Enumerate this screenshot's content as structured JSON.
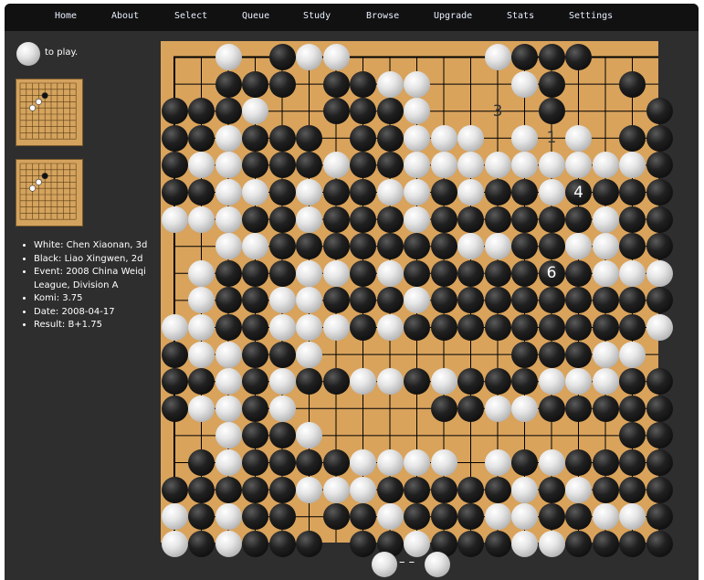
{
  "nav": {
    "items": [
      {
        "label": "Home"
      },
      {
        "label": "About"
      },
      {
        "label": "Select"
      },
      {
        "label": "Queue"
      },
      {
        "label": "Study"
      },
      {
        "label": "Browse"
      },
      {
        "label": "Upgrade"
      },
      {
        "label": "Stats"
      },
      {
        "label": "Settings"
      }
    ]
  },
  "to_play": {
    "color": "white",
    "label": "to play."
  },
  "game_info": {
    "items": [
      {
        "text": "White: Chen Xiaonan, 3d"
      },
      {
        "text": "Black: Liao Xingwen, 2d"
      },
      {
        "text": "Event: 2008 China Weiqi League, Division A"
      },
      {
        "text": "Komi: 3.75"
      },
      {
        "text": "Date: 2008-04-17"
      },
      {
        "text": "Result: B+1.75"
      }
    ]
  },
  "footer": {
    "separator": "– –"
  },
  "board": {
    "size": 19,
    "rows": [
      "..w.bww.....wbbb...",
      "..bbb.bbww...wb..b.",
      "bbbw..bbbw....b...b",
      "bbwbbb.bbwww.w.w.bb",
      "bwwbbbwbbwwwwwwwwwb",
      "bbwwbwbbwwbwbbwbbbb",
      "wwwbbwbbbwbbbbbbwbb",
      "..wwbbbbbbbwwbbwwbb",
      ".wbbbwwbwbbbbbbbwww",
      ".wbbwwbbbwbbbbbbbbb",
      "wwbbwwwbwbbbbbbbbbw",
      "bwwbbw.......bbbww.",
      "bbwbwbbwwbwbbbwwwbb",
      "bwwbw.....bbwwbbbbb",
      "..wbbw...........bb",
      ".bwbbbbwwww.wbwbbbb",
      "bbbbbwwwbbbbbwbwbbb",
      "wbwbb.bbwbbbwwbbwwb",
      "wbwbbb.bbwbbbwwbbbb"
    ],
    "numbers": [
      {
        "row": 2,
        "col": 12,
        "label": "3"
      },
      {
        "row": 3,
        "col": 14,
        "label": "1"
      },
      {
        "row": 5,
        "col": 15,
        "label": "4"
      },
      {
        "row": 8,
        "col": 14,
        "label": "6"
      }
    ]
  },
  "thumbs": [
    {
      "stones": [
        {
          "r": 2,
          "c": 4,
          "k": "b"
        },
        {
          "r": 3,
          "c": 3,
          "k": "w"
        },
        {
          "r": 4,
          "c": 2,
          "k": "w"
        }
      ]
    },
    {
      "stones": [
        {
          "r": 2,
          "c": 4,
          "k": "b"
        },
        {
          "r": 3,
          "c": 3,
          "k": "w"
        },
        {
          "r": 4,
          "c": 2,
          "k": "w"
        }
      ]
    }
  ]
}
